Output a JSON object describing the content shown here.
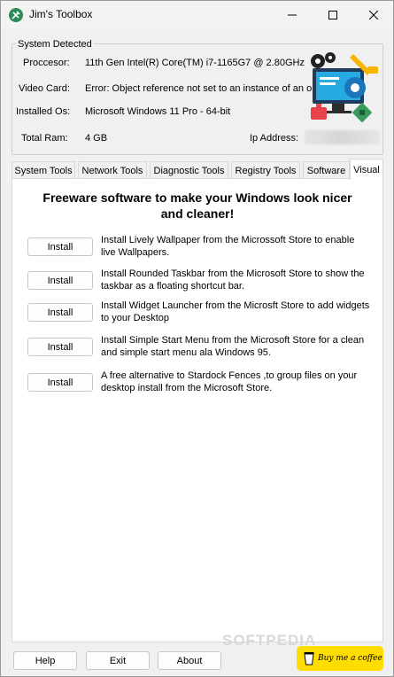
{
  "window": {
    "title": "Jim's Toolbox"
  },
  "system": {
    "group_title": "System Detected",
    "processor_label": "Proccesor:",
    "processor_value": "11th Gen Intel(R) Core(TM) i7-1165G7 @ 2.80GHz",
    "video_label": "Video Card:",
    "video_value": "Error: Object reference not set to an instance of an object.",
    "os_label": "Installed Os:",
    "os_value": "Microsoft Windows 11 Pro - 64-bit",
    "ram_label": "Total Ram:",
    "ram_value": "4 GB",
    "ip_label": "Ip Address:"
  },
  "tabs": [
    "System Tools",
    "Network Tools",
    "Diagnostic Tools",
    "Registry Tools",
    "Software",
    "Visual"
  ],
  "active_tab": "Visual",
  "visual": {
    "headline": "Freeware software to make your Windows look nicer and cleaner!",
    "install_label": "Install",
    "items": [
      "Install Lively Wallpaper from the Microssoft Store to enable live Wallpapers.",
      "Install Rounded Taskbar from the Microsoft Store to show the  taskbar as a floating shortcut bar.",
      "Install Widget Launcher from the Microsft Store to add widgets  to your Desktop",
      "Install Simple Start Menu from the Microsoft Store for a clean and simple start menu ala Windows 95.",
      "A free alternative to Stardock Fences ,to group files on your  desktop install from the Microsoft Store."
    ]
  },
  "footer": {
    "help": "Help",
    "exit": "Exit",
    "about": "About",
    "coffee": "Buy me a coffee",
    "watermark": "SOFTPEDIA"
  },
  "colors": {
    "coffee_bg": "#ffdd00",
    "panel_bg": "#ffffff",
    "window_bg": "#f0f0f0"
  }
}
